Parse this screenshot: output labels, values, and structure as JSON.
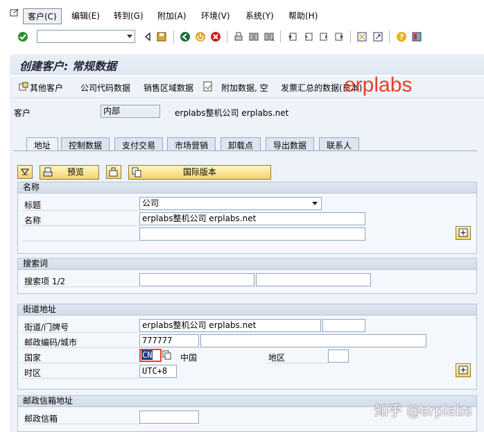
{
  "menu": {
    "items": [
      "客户(C)",
      "编辑(E)",
      "转到(G)",
      "附加(A)",
      "环境(V)",
      "系统(Y)",
      "帮助(H)"
    ]
  },
  "toolbar": {
    "command_value": "",
    "icons": [
      "enter-icon",
      "back-icon",
      "save-icon",
      "back-green-icon",
      "exit-icon",
      "cancel-icon",
      "print-icon",
      "find-icon",
      "find-next-icon",
      "first-page-icon",
      "prev-page-icon",
      "next-page-icon",
      "last-page-icon",
      "new-session-icon",
      "shortcut-icon",
      "help-icon",
      "customize-icon"
    ]
  },
  "title": "创建客户: 常规数据",
  "app_toolbar": {
    "other_customer": "其他客户",
    "company_code_data": "公司代码数据",
    "sales_area_data": "销售区域数据",
    "additional_data": "附加数据, 空",
    "invoice_summary": "发票汇总的数据(日本)"
  },
  "watermarks": {
    "brand": "erplabs",
    "zhihu": "知乎 @erplabs"
  },
  "header": {
    "customer_label": "客户",
    "customer_value": "内部",
    "customer_name": "erplabs整机公司 erplabs.net"
  },
  "tabs": [
    "地址",
    "控制数据",
    "支付交易",
    "市场营销",
    "卸载点",
    "导出数据",
    "联系人"
  ],
  "actions": {
    "preview": "预览",
    "intl_version": "国际版本"
  },
  "name_group": {
    "title": "名称",
    "salutation_label": "标题",
    "salutation_value": "公司",
    "name_label": "名称",
    "name_value": "erplabs整机公司 erplabs.net",
    "name2_value": ""
  },
  "search_group": {
    "title": "搜索词",
    "search_label": "搜索项 1/2",
    "search1": "",
    "search2": ""
  },
  "street_group": {
    "title": "街道地址",
    "street_label": "街道/门牌号",
    "street_value": "erplabs整机公司 erplabs.net",
    "house_no": "",
    "postal_label": "邮政编码/城市",
    "postal_value": "777777",
    "city_value": "",
    "country_label": "国家",
    "country_value": "CN",
    "country_name": "中国",
    "region_label": "地区",
    "region_value": "",
    "timezone_label": "时区",
    "timezone_value": "UTC+8"
  },
  "po_group": {
    "title": "邮政信箱地址",
    "po_label": "邮政信箱",
    "po_value": ""
  },
  "colors": {
    "accent_red": "#e8402a",
    "panel_bg": "#eef3fa",
    "button_yellow": "#f3d56b"
  }
}
